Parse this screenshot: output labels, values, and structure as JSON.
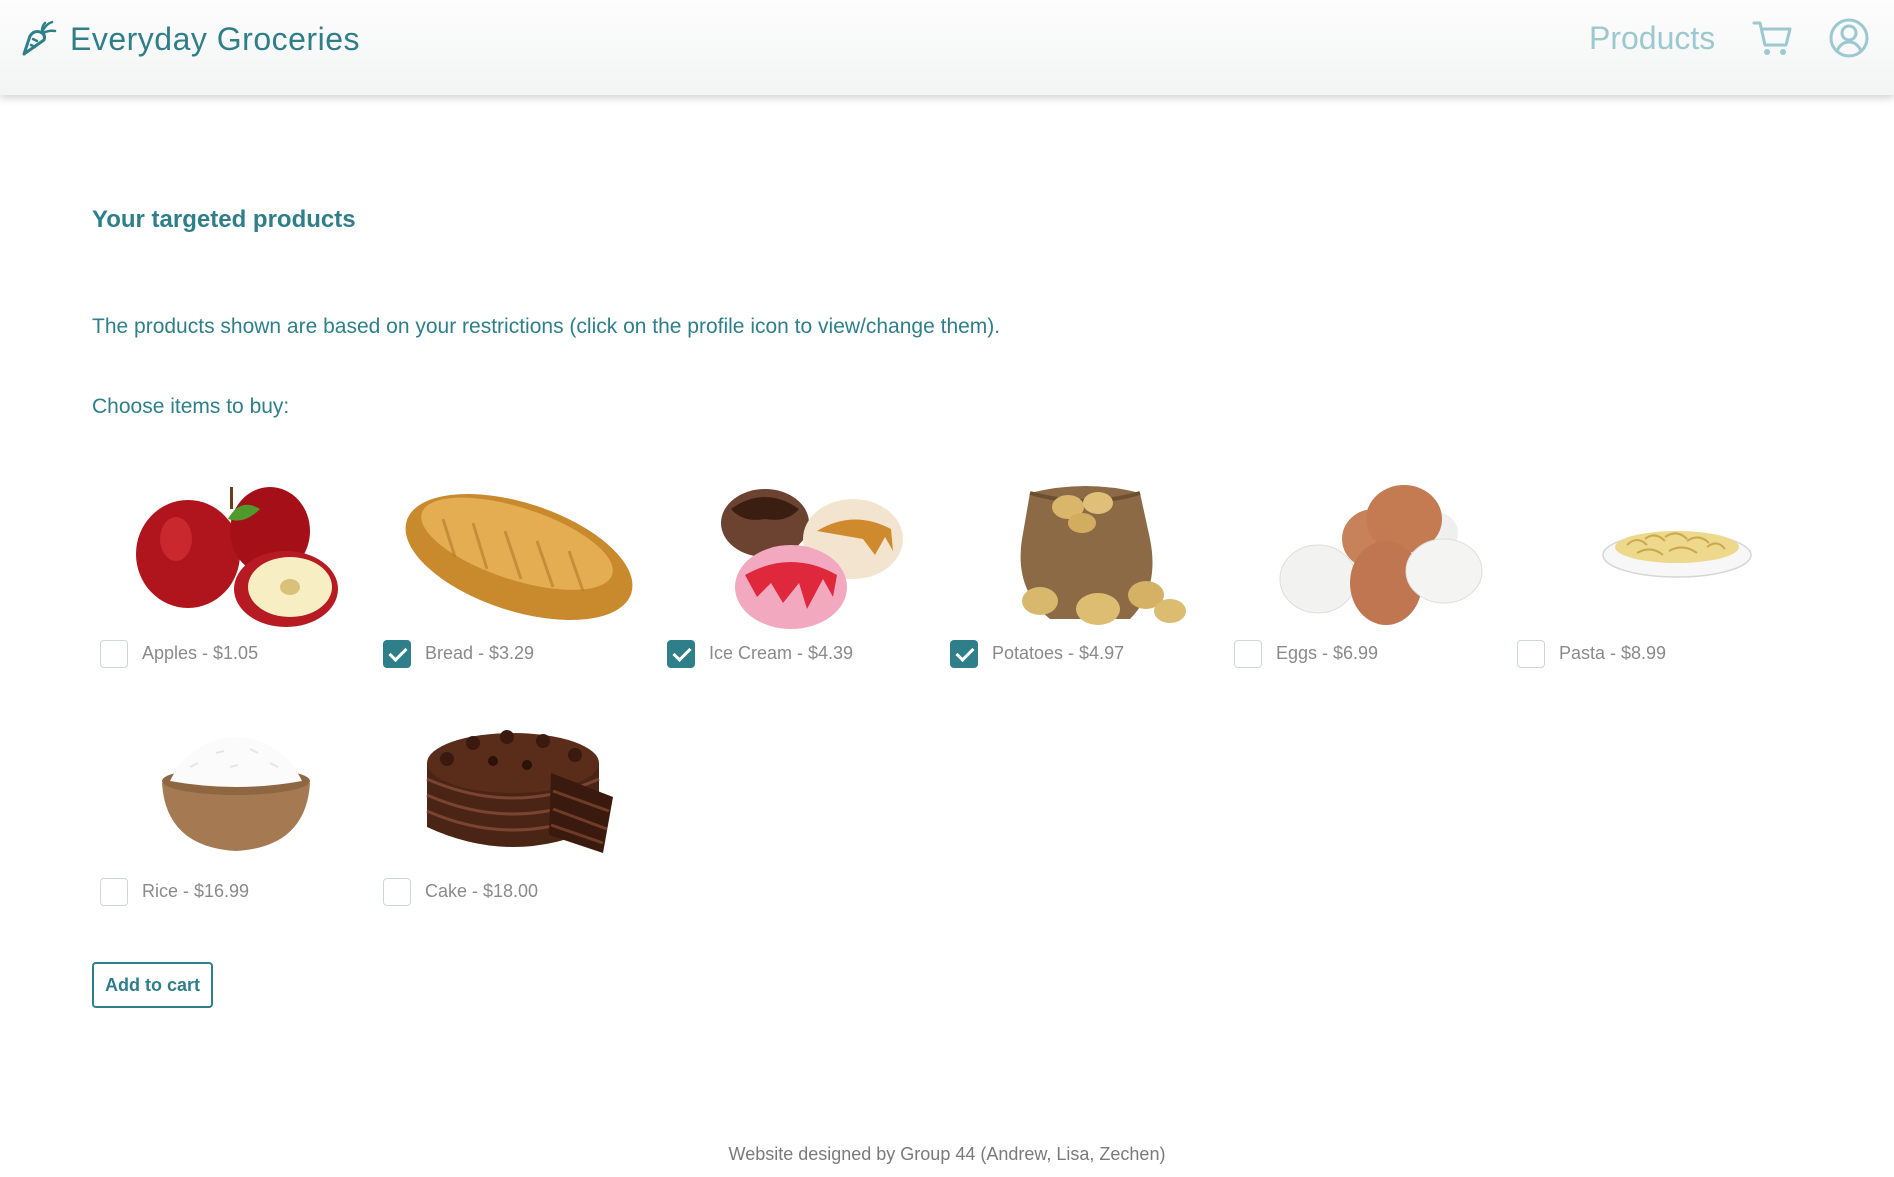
{
  "header": {
    "brand": "Everyday Groceries",
    "nav_products": "Products",
    "icons": [
      "carrot-logo-icon",
      "cart-icon",
      "profile-icon"
    ],
    "accent_color": "#2f7f8a",
    "nav_color": "#9cc8cf"
  },
  "main": {
    "title": "Your targeted products",
    "description": "The products shown are based on your restrictions (click on the profile icon to view/change them).",
    "choose": "Choose items to buy:",
    "items": [
      {
        "label": "Apples - $1.05",
        "checked": false,
        "image": "apples"
      },
      {
        "label": "Bread - $3.29",
        "checked": true,
        "image": "bread"
      },
      {
        "label": "Ice Cream - $4.39",
        "checked": true,
        "image": "ice-cream"
      },
      {
        "label": "Potatoes - $4.97",
        "checked": true,
        "image": "potatoes"
      },
      {
        "label": "Eggs - $6.99",
        "checked": false,
        "image": "eggs"
      },
      {
        "label": "Pasta - $8.99",
        "checked": false,
        "image": "pasta"
      },
      {
        "label": "Rice - $16.99",
        "checked": false,
        "image": "rice"
      },
      {
        "label": "Cake - $18.00",
        "checked": false,
        "image": "cake"
      }
    ],
    "add_to_cart": "Add to cart"
  },
  "footer": {
    "text": "Website designed by Group 44 (Andrew, Lisa, Zechen)"
  }
}
